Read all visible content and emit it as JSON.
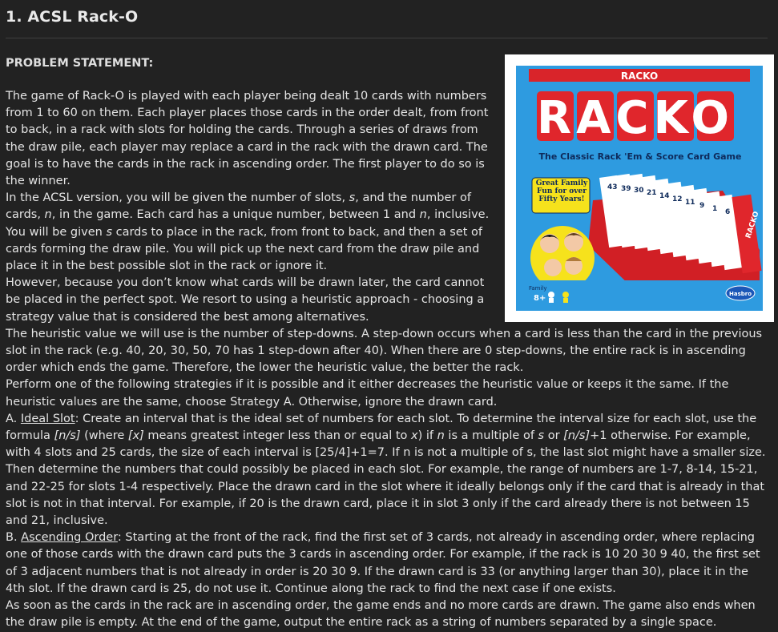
{
  "page": {
    "title": "1. ACSL Rack-O",
    "section_heading": "PROBLEM STATEMENT:"
  },
  "box_art": {
    "top_banner": "RACKO",
    "logo": "RACKO",
    "subtitle": "The Classic Rack 'Em & Score Card Game",
    "badge": "Great Family Fun for over Fifty Years!",
    "card_numbers": [
      "43",
      "39",
      "30",
      "21",
      "14",
      "12",
      "11",
      "9",
      "1",
      "6"
    ],
    "side_logo": "RACKO",
    "footer_left": "Family",
    "footer_age": "8+",
    "publisher": "Hasbro"
  },
  "paragraphs": {
    "p1": "The game of Rack-O is played with each player being dealt 10 cards with numbers from 1 to 60 on them.  Each player places those cards in the order dealt, from front to back, in a rack with slots for holding the cards.  Through a series of draws from the draw pile, each player may replace a card in the rack with the drawn card.  The goal is to have the cards in the rack in ascending order.  The first player to do so is the winner.",
    "p2": {
      "a": "In the ACSL version, you will be given the number of slots, ",
      "s1": "s",
      "b": ", and the number of cards, ",
      "n1": "n",
      "c": ", in the game.  Each card has a unique number, between 1 and ",
      "n2": "n",
      "d": ", inclusive.  You will be given ",
      "s2": "s",
      "e": " cards to place in the rack, from front to back, and then a set of cards forming the draw pile.  You will pick up the next card from the draw pile and place it in the best possible slot in the rack or ignore it."
    },
    "p3": "However, because you don’t know what cards will be drawn later, the card cannot be placed in the perfect spot.  We resort to using a heuristic approach - choosing a strategy value that is considered the best among alternatives.",
    "p4": "The heuristic value we will use is the number of step-downs.  A step-down occurs when a card is less than the card in the previous slot in the rack (e.g. 40, 20, 30, 50, 70 has 1 step-down after 40).  When there are 0 step-downs, the entire rack is in ascending order which ends the game.  Therefore, the lower the heuristic value, the better the rack.",
    "p5": "Perform one of the following strategies if it is possible and it either decreases the heuristic value or keeps it the same.  If the heuristic values are the same, choose Strategy A.  Otherwise, ignore the drawn card.",
    "p6": {
      "prefix": "A. ",
      "term": "Ideal Slot",
      "a": ": Create an interval that is the ideal set of numbers for each slot.  To determine the interval size for each slot, use the formula ",
      "f1": "[n/s]",
      "b": " (where ",
      "f2": "[x]",
      "c": " means greatest integer less than or equal to ",
      "x": "x",
      "d": ") if ",
      "n": "n",
      "e": " is a multiple of ",
      "s": "s",
      "f": " or ",
      "f3": "[n/s]",
      "g": "+1 otherwise.  For example, with 4 slots and 25 cards, the size of each interval is [25/4]+1=7.  If n is not a multiple of s, the last slot might have a smaller size.  Then determine the numbers that could possibly be placed in each slot.  For example, the range of numbers are 1-7, 8-14, 15-21, and 22-25 for slots 1-4 respectively.  Place the drawn card in the slot where it ideally belongs only if the card that is already in that slot is not in that interval.  For example, if 20 is the drawn card, place it in slot 3 only if the card already there is not between 15 and 21, inclusive."
    },
    "p7": {
      "prefix": "B. ",
      "term": "Ascending Order",
      "text": ": Starting at the front of the rack, find the first set of 3 cards, not already in ascending order, where replacing one of those cards with the drawn card puts the 3 cards in ascending order.  For example, if the rack is 10 20 30 9 40, the first set of 3 adjacent numbers that is not already in order is 20 30 9.  If the drawn card is 33 (or anything larger than 30), place it in the 4th slot.  If the drawn card is 25, do not use it.  Continue along the rack to find the next case if one exists."
    },
    "p8": "As soon as the cards in the rack are in ascending order, the game ends and no more cards are drawn.  The game also ends when the draw pile is empty.  At the end of the game, output the entire rack as a string of numbers separated by a single space."
  }
}
